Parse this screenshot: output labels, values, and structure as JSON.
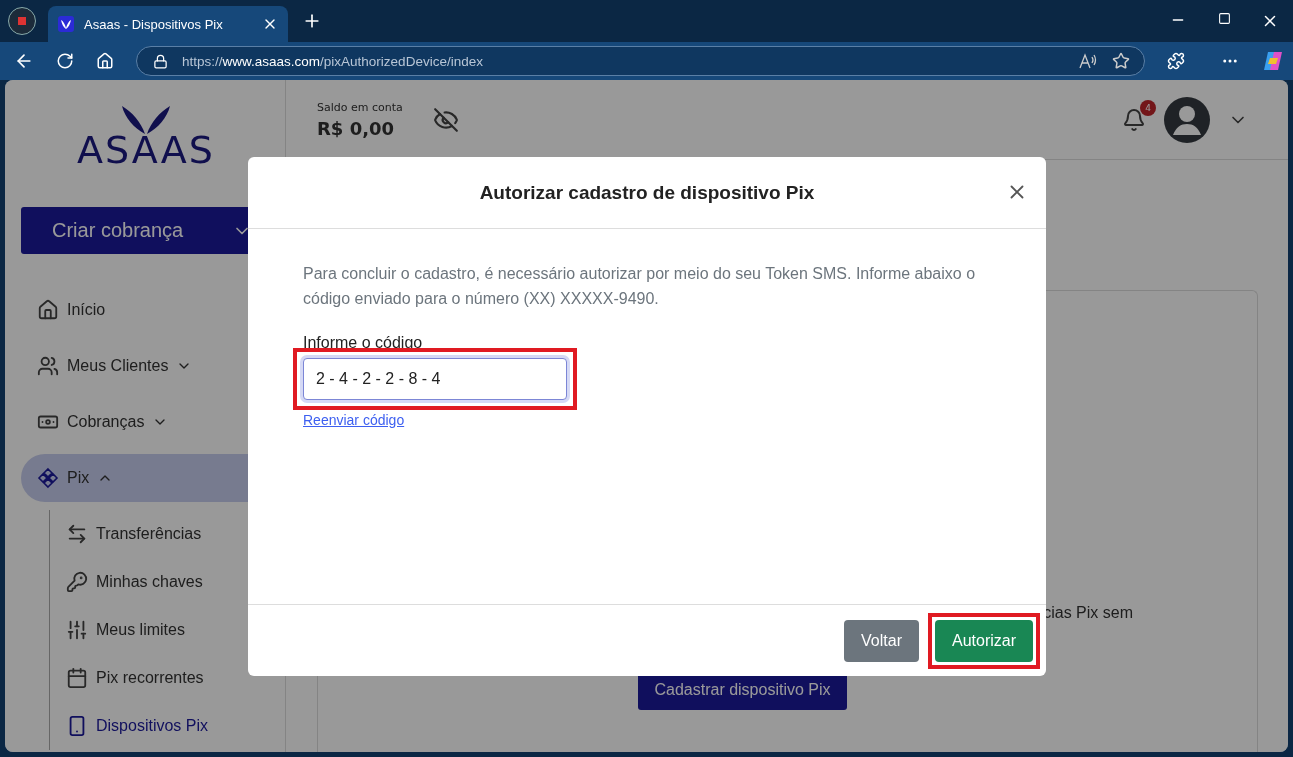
{
  "browser": {
    "tab_title": "Asaas - Dispositivos Pix",
    "url": "https://**www.asaas.com**/pixAuthorizedDevice/index"
  },
  "sidebar": {
    "logo": "ASAAS",
    "create_button": "Criar cobrança",
    "items": [
      {
        "kind": "item",
        "label": "Início",
        "selected": false
      },
      {
        "kind": "group",
        "label": "Meus Clientes",
        "selected": false,
        "expanded": false
      },
      {
        "kind": "group",
        "label": "Cobranças",
        "selected": false,
        "expanded": false
      },
      {
        "kind": "group",
        "label": "Pix",
        "selected": true,
        "expanded": true,
        "children": [
          {
            "label": "Transferências",
            "selected": false
          },
          {
            "label": "Minhas chaves",
            "selected": false
          },
          {
            "label": "Meus limites",
            "selected": false
          },
          {
            "label": "Pix recorrentes",
            "selected": false
          },
          {
            "label": "Dispositivos Pix",
            "selected": true
          }
        ]
      }
    ]
  },
  "header": {
    "balance_label": "Saldo em conta",
    "balance": "R$ 0,00",
    "notifications": "4"
  },
  "content": {
    "card_text": "cias Pix sem",
    "button": "Cadastrar dispositivo Pix"
  },
  "modal": {
    "title": "Autorizar cadastro de dispositivo Pix",
    "message": "Para concluir o cadastro, é necessário autorizar por meio do seu Token SMS. Informe abaixo o código enviado para o número (XX) XXXXX-9490.",
    "field_label": "Informe o código",
    "field_value": "2 - 4 - 2 - 2 - 8 - 4",
    "field_highlighted": true,
    "link": "Reenviar código",
    "buttons": [
      {
        "kind": "secondary",
        "label": "Voltar",
        "highlighted": false
      },
      {
        "kind": "primary",
        "label": "Autorizar",
        "highlighted": true
      }
    ]
  }
}
